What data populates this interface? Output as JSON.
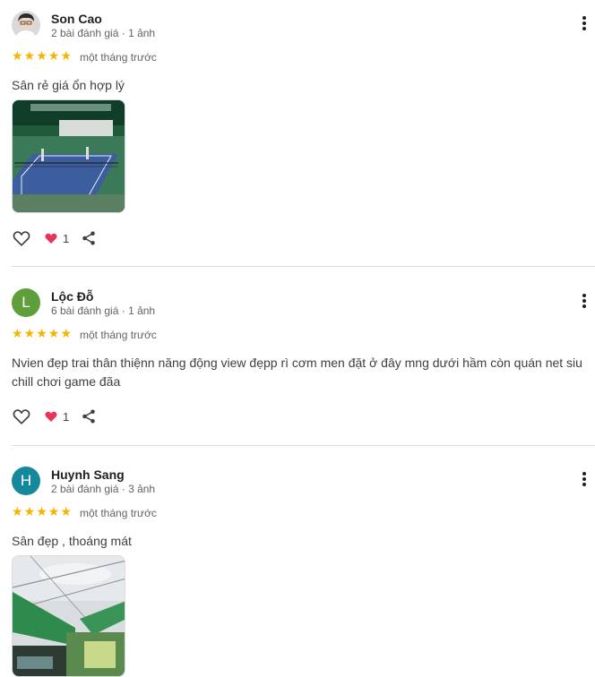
{
  "reviews": [
    {
      "name": "Son Cao",
      "meta": "2 bài đánh giá · 1 ảnh",
      "rating": 5,
      "date": "một tháng trước",
      "text": "Sân rẻ giá ổn hợp lý",
      "likes": "1",
      "avatar_type": "photo",
      "photo": "pickleball-court"
    },
    {
      "name": "Lộc Đỗ",
      "meta": "6 bài đánh giá · 1 ảnh",
      "rating": 5,
      "date": "một tháng trước",
      "text": "Nvien đẹp trai thân thiệnn năng động view đẹpp rì cơm men đặt ở đây mng dưới hầm còn quán net siu chill chơi game đãa",
      "likes": "1",
      "avatar_letter": "L",
      "avatar_color": "#5e9f3c"
    },
    {
      "name": "Huynh Sang",
      "meta": "2 bài đánh giá · 3 ảnh",
      "rating": 5,
      "date": "một tháng trước",
      "text": "Sân đẹp , thoáng mát",
      "avatar_letter": "H",
      "avatar_color": "#15899b",
      "photo": "green-roof-building"
    }
  ],
  "colors": {
    "star": "#f6b400",
    "heart": "#e8345a",
    "divider": "#dadce0"
  },
  "icons": [
    "more-vert-icon",
    "thumb-heart-outline-icon",
    "heart-icon",
    "share-icon",
    "star-icon"
  ]
}
